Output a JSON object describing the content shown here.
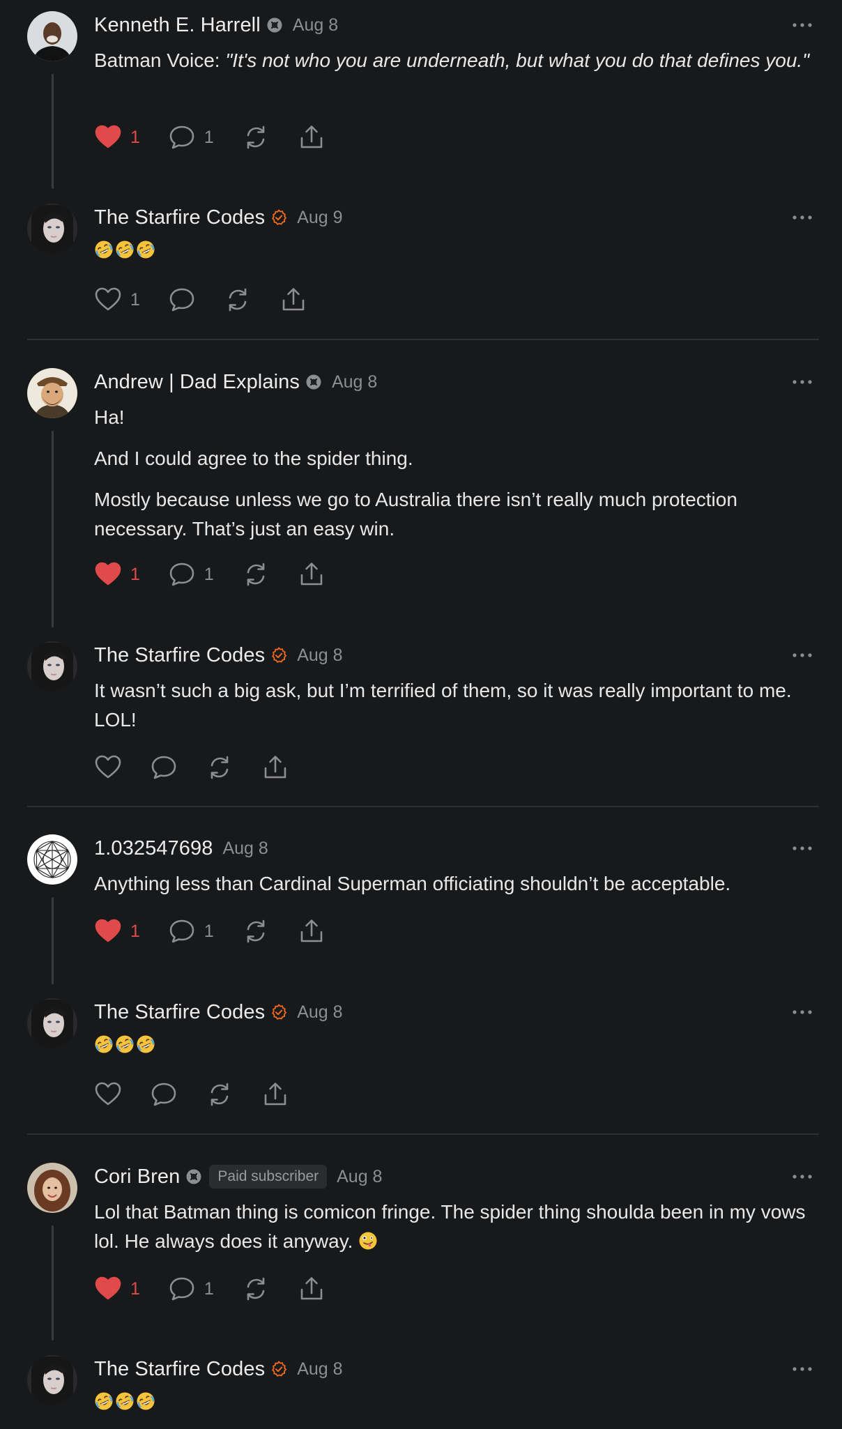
{
  "colors": {
    "background": "#18191b",
    "liked": "#e14a4a",
    "verified_badge": "#f46d1f",
    "muted": "#8d8e91"
  },
  "comments": [
    {
      "author": "Kenneth E. Harrell",
      "badge": "subscriber-icon",
      "date": "Aug 8",
      "body_prefix": "Batman Voice: ",
      "body_italic": "\"It's not who you are underneath, but what you do that defines you.\"",
      "likes": "1",
      "replies": "1",
      "liked": true
    },
    {
      "author": "The Starfire Codes",
      "badge": "verified-icon",
      "date": "Aug 9",
      "body_emoji": [
        "rofl-emoji",
        "rofl-emoji",
        "rofl-emoji"
      ],
      "likes": "1",
      "liked": false
    },
    {
      "author": "Andrew | Dad Explains",
      "badge": "subscriber-icon",
      "date": "Aug 8",
      "paragraphs": [
        "Ha!",
        "And I could agree to the spider thing.",
        "Mostly because unless we go to Australia there isn’t really much protection necessary. That’s just an easy win."
      ],
      "likes": "1",
      "replies": "1",
      "liked": true
    },
    {
      "author": "The Starfire Codes",
      "badge": "verified-icon",
      "date": "Aug 8",
      "paragraphs": [
        "It wasn’t such a big ask, but I’m terrified of them, so it was really important to me. LOL!"
      ],
      "liked": false
    },
    {
      "author": "1.032547698",
      "date": "Aug 8",
      "paragraphs": [
        "Anything less than Cardinal Superman officiating shouldn’t be acceptable."
      ],
      "likes": "1",
      "replies": "1",
      "liked": true
    },
    {
      "author": "The Starfire Codes",
      "badge": "verified-icon",
      "date": "Aug 8",
      "body_emoji": [
        "rofl-emoji",
        "rofl-emoji",
        "rofl-emoji"
      ],
      "liked": false
    },
    {
      "author": "Cori Bren",
      "badge": "subscriber-icon",
      "paid_label": "Paid subscriber",
      "date": "Aug 8",
      "paragraphs": [
        "Lol that Batman thing is comicon fringe. The spider thing shoulda been in my vows lol. He always does it anyway."
      ],
      "trailing_emoji": "zany-face-emoji",
      "likes": "1",
      "replies": "1",
      "liked": true
    },
    {
      "author": "The Starfire Codes",
      "badge": "verified-icon",
      "date": "Aug 8",
      "body_emoji": [
        "rofl-emoji",
        "rofl-emoji",
        "rofl-emoji"
      ]
    }
  ]
}
